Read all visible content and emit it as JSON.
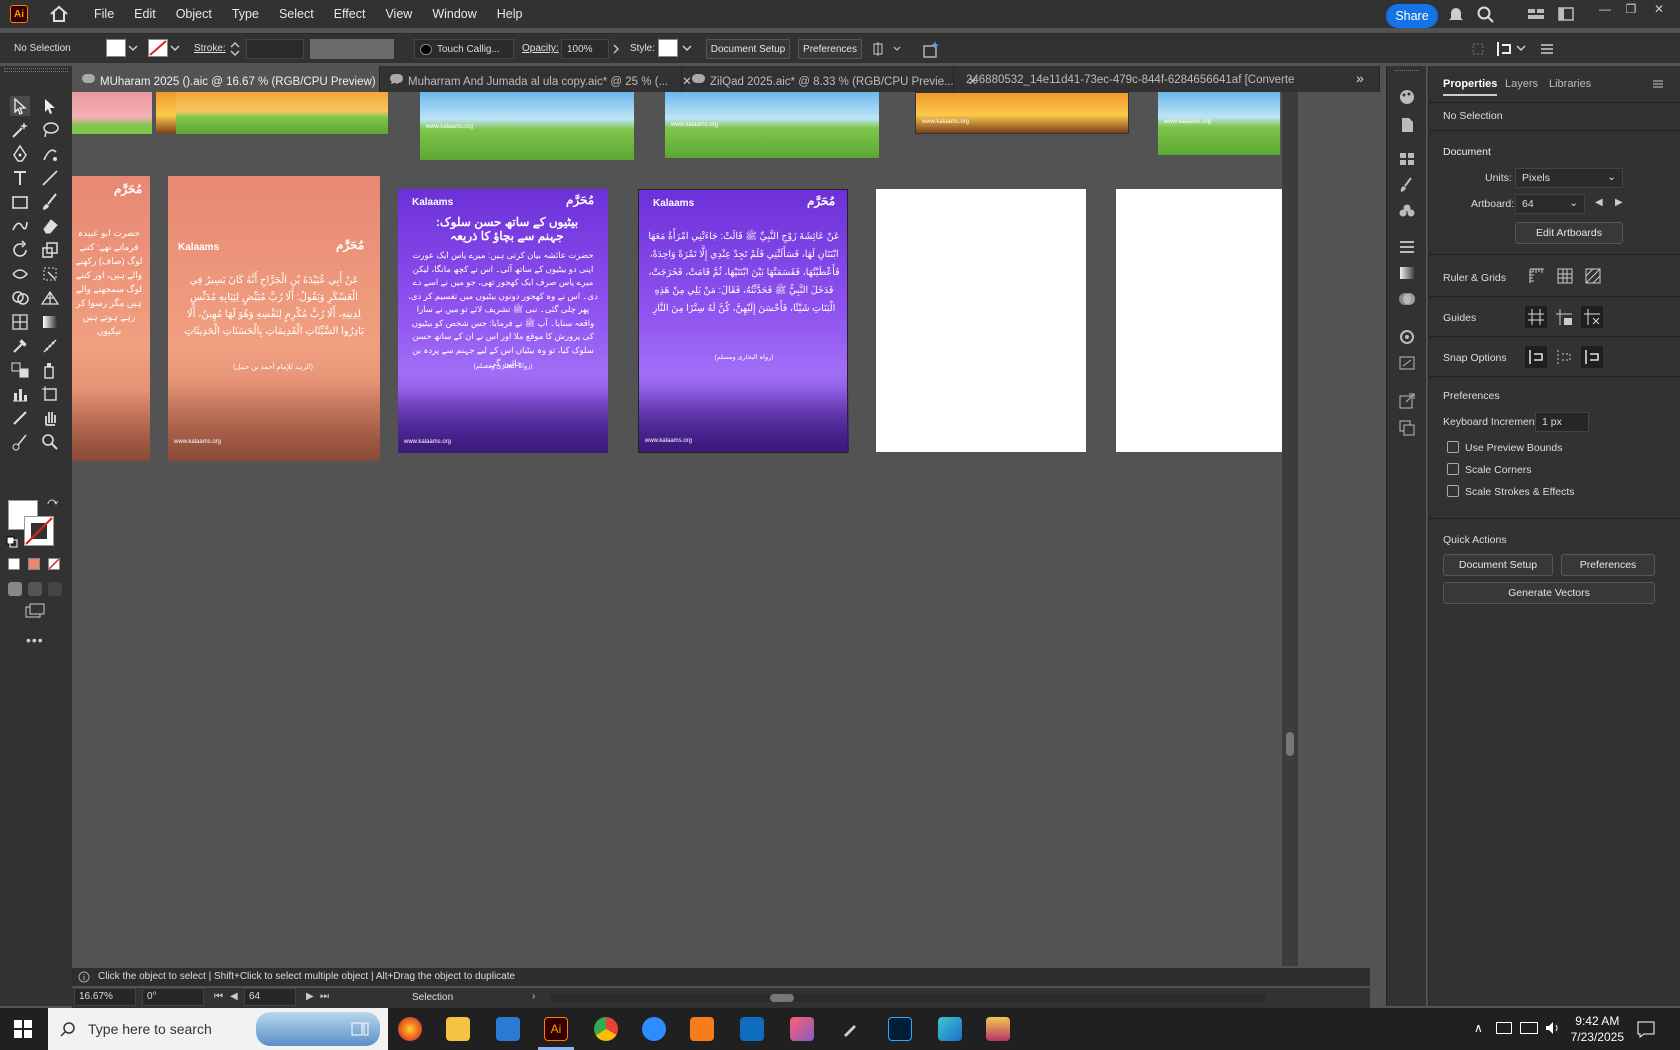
{
  "app": {
    "logo": "Ai"
  },
  "menu": [
    "File",
    "Edit",
    "Object",
    "Type",
    "Select",
    "Effect",
    "View",
    "Window",
    "Help"
  ],
  "topbar": {
    "share_label": "Share",
    "win_min": "—",
    "win_restore": "❐",
    "win_close": "✕"
  },
  "control_bar": {
    "selection": "No Selection",
    "stroke_label": "Stroke:",
    "brush": "Touch Callig...",
    "opacity_label": "Opacity:",
    "opacity_value": "100%",
    "style_label": "Style:",
    "document_setup": "Document Setup",
    "preferences": "Preferences"
  },
  "tabs": [
    {
      "label": "MUharam 2025 ().aic @ 16.67 % (RGB/CPU Preview)",
      "close": "✕"
    },
    {
      "label": "Muharram And Jumada al ula copy.aic* @ 25 % (...",
      "close": "✕"
    },
    {
      "label": "ZilQad 2025.aic* @ 8.33 % (RGB/CPU Previe...",
      "close": "✕"
    },
    {
      "label": "246880532_14e11d41-73ec-479c-844f-6284656641af [Converte",
      "close": ""
    }
  ],
  "tabs_overflow": "»",
  "artboards": {
    "brand": "Kalaams",
    "url": "www.kalaams.org",
    "badge": "مُحَرَّم",
    "art3_title": "بیٹیوں کے ساتھ حسن سلوک: جہنم سے بچاؤ کا ذریعہ",
    "art3_body": "حضرت عائشہ بیان کرتی ہیں: میرے پاس ایک عورت اپنی دو بیٹیوں کے ساتھ آئی۔ اس نے کچھ مانگا، لیکن میرے پاس صرف ایک کھجور تھی، جو میں نے اسے دے دی۔ اس نے وہ کھجور دونوں بیٹیوں میں تقسیم کر دی، پھر چلی گئی۔ نبی ﷺ تشریف لائے تو میں نے سارا واقعہ سنایا۔ آپ ﷺ نے فرمایا: جس شخص کو بیٹیوں کی پرورش کا موقع ملا اور اس نے ان کے ساتھ حسن سلوک کیا، تو وہ بیٹیاں اس کے لیے جہنم سے پردہ بن جائیں گی۔",
    "art3_ref": "(رواہ البخاری ومسلم)",
    "art4_body": "عَنْ عَائِشَةَ زَوْجِ النَّبِيِّ ﷺ قَالَتْ: جَاءَتْنِي امْرَأَةٌ مَعَهَا ابْنَتَانِ لَهَا، فَسَأَلَتْنِي فَلَمْ تَجِدْ عِنْدِي إِلَّا تَمْرَةً وَاحِدَةً، فَأَعْطَيْتُهَا، فَقَسَمَتْهَا بَيْنَ ابْنَتَيْهَا، ثُمَّ قَامَتْ، فَخَرَجَتْ، فَدَخَلَ النَّبِيُّ ﷺ فَحَدَّثْتُهُ، فَقَالَ: مَنْ يَلِي مِنْ هَذِهِ الْبَنَاتِ شَيْئًا، فَأَحْسَنَ إِلَيْهِنَّ، كُنَّ لَهُ سِتْرًا مِنَ النَّارِ",
    "art4_ref": "(رواہ البخاری ومسلم)",
    "art2_body": "عَنْ أَبِي عُبَيْدَةَ بْنِ الْجَرَّاحِ أَنَّهُ كَانَ يَسِيرُ فِي الْعَسْكَرِ وَيَقُولُ: أَلَا رُبَّ مُبَيِّضٍ لِثِيَابِهِ مُدَنِّسٍ لِدِينِهِ، أَلَا رُبَّ مُكْرِمٍ لِنَفْسِهِ وَهُوَ لَهَا مُهِينٌ، أَلَا بَادِرُوا السَّيِّئَاتِ الْقَدِيمَاتِ بِالْحَسَنَاتِ الْحَدِيثَاتِ",
    "art2_ref": "(الزہد للإمام أحمد بن حنبل)",
    "art1_body": "حضرت ابو عبیدہ فرماتے تھے: کتنے لوگ (صاف) رکھنے والے ہیں، اور کتنے لوگ سمجھنے والے ہیں مگر رسوا کر رہے ہوتے ہیں نیکیوں"
  },
  "status": {
    "hint": "Click the object to select  |  Shift+Click to select multiple object  |  Alt+Drag the object to duplicate",
    "zoom": "16.67%",
    "rotation": "0°",
    "artboard": "64",
    "tool": "Selection"
  },
  "properties": {
    "tabs": [
      "Properties",
      "Layers",
      "Libraries"
    ],
    "selection": "No Selection",
    "document_header": "Document",
    "units_label": "Units:",
    "units_value": "Pixels",
    "artboard_label": "Artboard:",
    "artboard_value": "64",
    "edit_artboards": "Edit Artboards",
    "ruler_grids": "Ruler & Grids",
    "guides": "Guides",
    "snap_options": "Snap Options",
    "preferences_header": "Preferences",
    "keyboard_increment_label": "Keyboard Increment:",
    "keyboard_increment_value": "1 px",
    "use_preview_bounds": "Use Preview Bounds",
    "scale_corners": "Scale Corners",
    "scale_strokes": "Scale Strokes & Effects",
    "quick_actions": "Quick Actions",
    "document_setup": "Document Setup",
    "preferences": "Preferences",
    "generate_vectors": "Generate Vectors"
  },
  "taskbar": {
    "search_placeholder": "Type here to search",
    "time": "9:42 AM",
    "date": "7/23/2025"
  }
}
